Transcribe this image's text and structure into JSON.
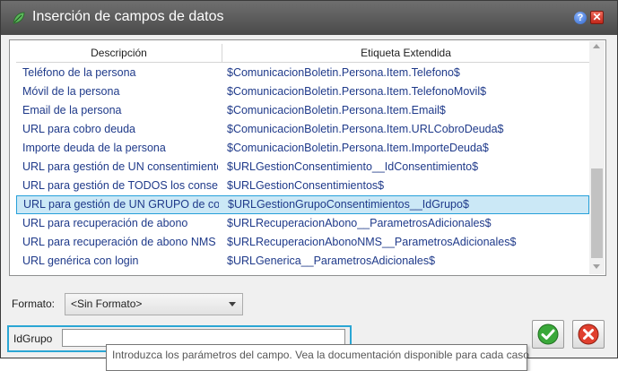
{
  "window": {
    "title": "Inserción de campos de datos",
    "help_label": "?",
    "close_label": "✕"
  },
  "grid": {
    "columns": {
      "description": "Descripción",
      "tag": "Etiqueta Extendida"
    },
    "rows": [
      {
        "description": "Teléfono de la persona",
        "tag": "$ComunicacionBoletin.Persona.Item.Telefono$"
      },
      {
        "description": "Móvil de la persona",
        "tag": "$ComunicacionBoletin.Persona.Item.TelefonoMovil$"
      },
      {
        "description": "Email de la persona",
        "tag": "$ComunicacionBoletin.Persona.Item.Email$"
      },
      {
        "description": "URL para cobro deuda",
        "tag": "$ComunicacionBoletin.Persona.Item.URLCobroDeuda$"
      },
      {
        "description": "Importe deuda de la persona",
        "tag": "$ComunicacionBoletin.Persona.Item.ImporteDeuda$"
      },
      {
        "description": "URL para gestión de UN consentimiento",
        "tag": "$URLGestionConsentimiento__IdConsentimiento$"
      },
      {
        "description": "URL para gestión de TODOS los consentimientos",
        "tag": "$URLGestionConsentimientos$"
      },
      {
        "description": "URL para gestión de UN GRUPO de consentimientos",
        "tag": "$URLGestionGrupoConsentimientos__IdGrupo$",
        "selected": true
      },
      {
        "description": "URL para recuperación de abono",
        "tag": "$URLRecuperacionAbono__ParametrosAdicionales$"
      },
      {
        "description": "URL para recuperación de abono NMS",
        "tag": "$URLRecuperacionAbonoNMS__ParametrosAdicionales$"
      },
      {
        "description": "URL genérica con login",
        "tag": "$URLGenerica__ParametrosAdicionales$"
      }
    ]
  },
  "format": {
    "label": "Formato:",
    "selected": "<Sin Formato>"
  },
  "parameter": {
    "label": "IdGrupo",
    "value": ""
  },
  "tooltip": {
    "text": "Introduzca los parámetros del campo. Vea la documentación disponible para cada caso"
  },
  "colors": {
    "selection_border": "#26a0da",
    "selection_fill": "#cbe8f6",
    "link_text": "#1f3a8a",
    "param_highlight": "#2aa6d4"
  }
}
